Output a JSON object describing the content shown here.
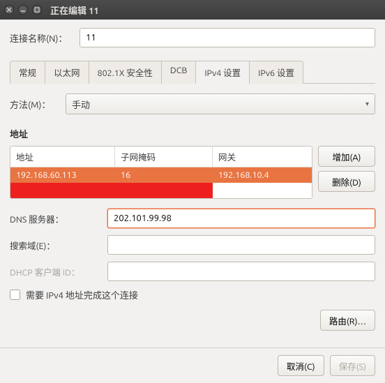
{
  "titlebar": {
    "title": "正在编辑 11"
  },
  "conn_name": {
    "label": "连接名称(N)：",
    "value": "11"
  },
  "tabs": [
    {
      "label": "常规"
    },
    {
      "label": "以太网"
    },
    {
      "label": "802.1X 安全性"
    },
    {
      "label": "DCB"
    },
    {
      "label": "IPv4 设置"
    },
    {
      "label": "IPv6 设置"
    }
  ],
  "method": {
    "label": "方法(M)：",
    "value": "手动"
  },
  "addr": {
    "heading": "地址",
    "headers": {
      "addr": "地址",
      "mask": "子网掩码",
      "gw": "网关"
    },
    "rows": [
      {
        "addr": "192.168.60.113",
        "mask": "16",
        "gw": "192.168.10.4"
      }
    ],
    "add_btn": "增加(A)",
    "del_btn": "删除(D)"
  },
  "dns": {
    "label": "DNS 服务器：",
    "value": "202.101.99.98"
  },
  "search": {
    "label": "搜索域(E)：",
    "value": ""
  },
  "dhcp": {
    "label": "DHCP 客户端 ID：",
    "value": ""
  },
  "require_ipv4": {
    "label": "需要 IPv4 地址完成这个连接"
  },
  "route_btn": "路由(R)…",
  "cancel_btn": "取消(C)",
  "save_btn": "保存(S)"
}
